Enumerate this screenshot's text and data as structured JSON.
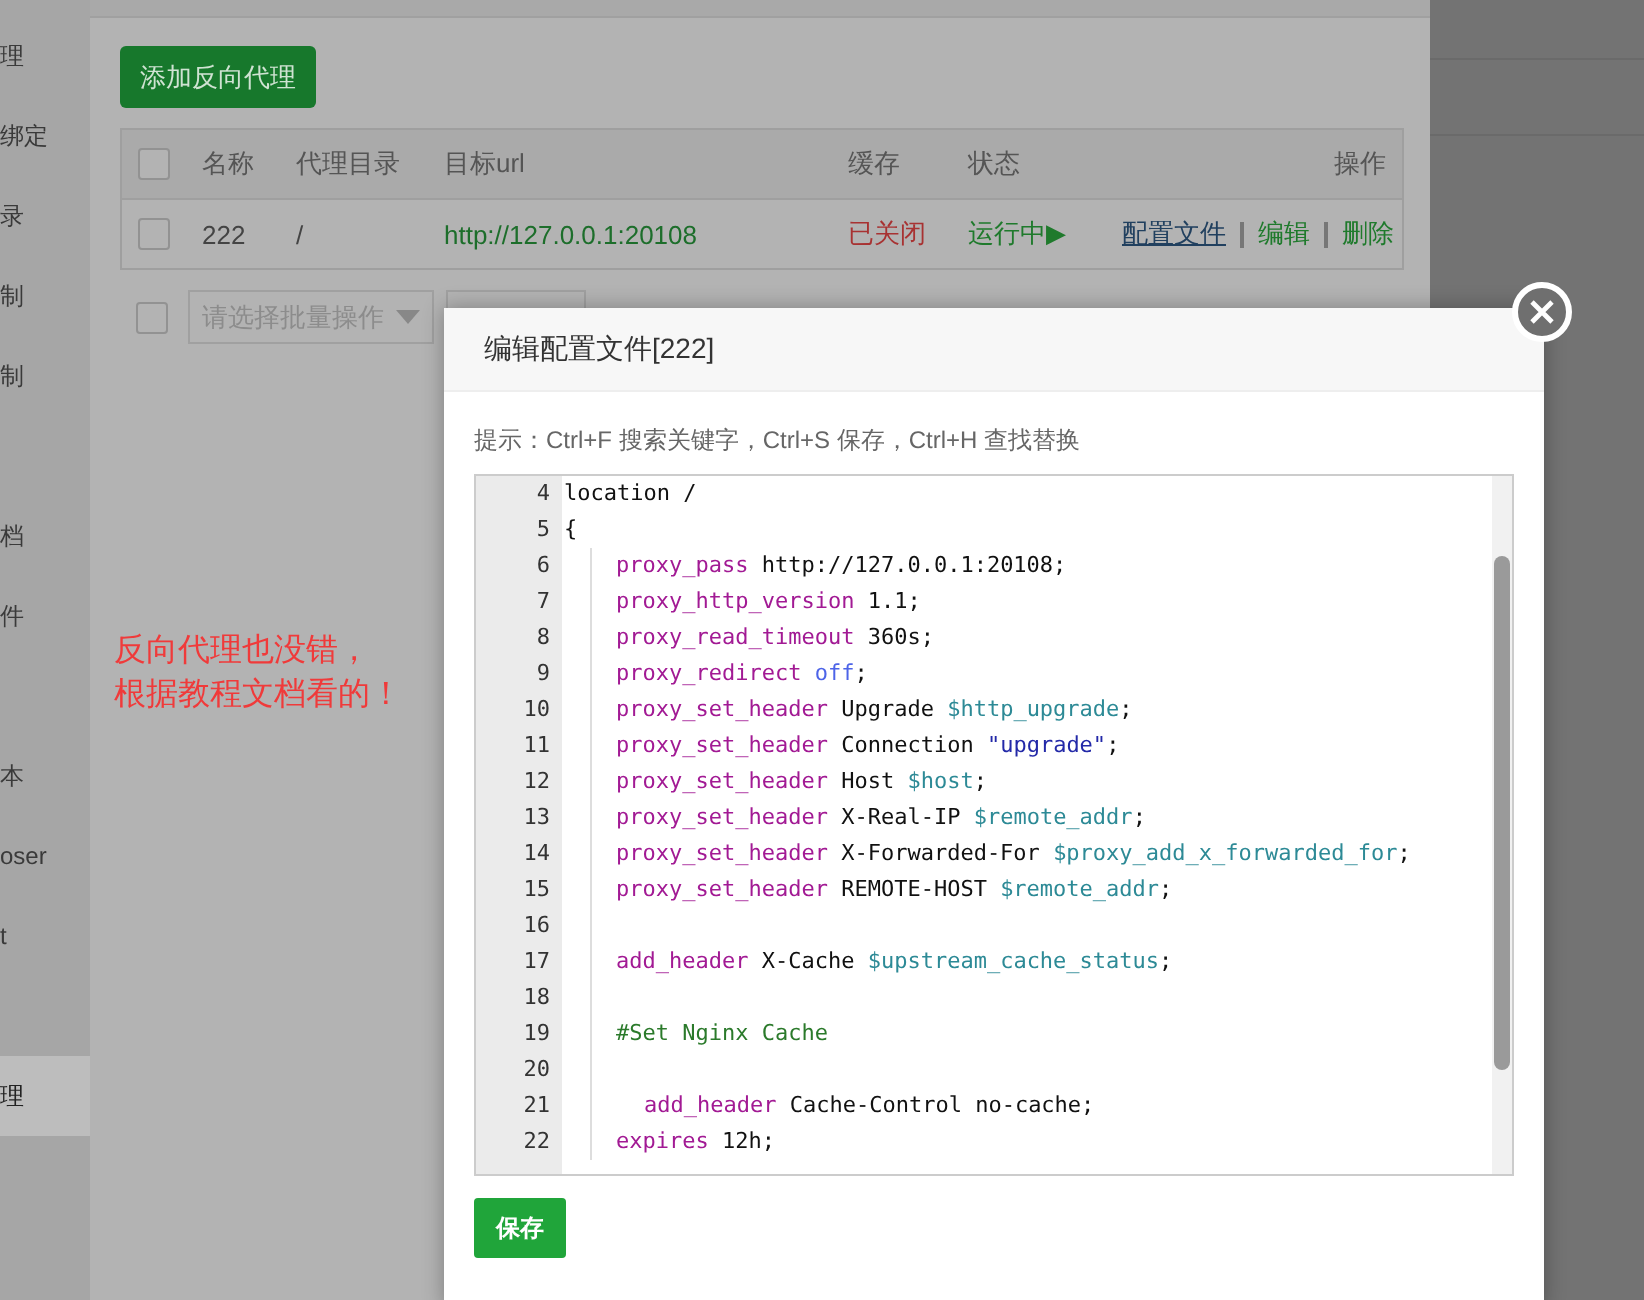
{
  "sidebar": {
    "items": [
      {
        "label": "理",
        "selected": false,
        "kind": "plain"
      },
      {
        "label": "绑定",
        "selected": false,
        "kind": "plain"
      },
      {
        "label": "录",
        "selected": false,
        "kind": "plain"
      },
      {
        "label": "制",
        "selected": false,
        "kind": "plain"
      },
      {
        "label": "制",
        "selected": false,
        "kind": "plain"
      },
      {
        "label": "档",
        "selected": false,
        "kind": "spaced"
      },
      {
        "label": "件",
        "selected": false,
        "kind": "plain"
      },
      {
        "label": "本",
        "selected": false,
        "kind": "spaced"
      },
      {
        "label": "oser",
        "selected": false,
        "kind": "plain"
      },
      {
        "label": "t",
        "selected": false,
        "kind": "plain"
      },
      {
        "label": "理",
        "selected": true,
        "kind": "spaced"
      }
    ]
  },
  "add_button": "添加反向代理",
  "table": {
    "header_checked": false,
    "columns": [
      "名称",
      "代理目录",
      "目标url",
      "缓存",
      "状态",
      "操作"
    ],
    "rows": [
      {
        "checked": false,
        "name": "222",
        "dir": "/",
        "url": "http://127.0.0.1:20108",
        "cache": "已关闭",
        "status": "运行中▶",
        "actions": [
          {
            "label": "配置文件",
            "kind": "link"
          },
          {
            "label": "编辑",
            "kind": "action"
          },
          {
            "label": "删除",
            "kind": "action"
          }
        ]
      }
    ]
  },
  "batch": {
    "checked": false,
    "placeholder": "请选择批量操作"
  },
  "annotation": [
    "反向代理也没错，",
    "根据教程文档看的！"
  ],
  "dialog": {
    "title": "编辑配置文件[222]",
    "hint": "提示：Ctrl+F 搜索关键字，Ctrl+S 保存，Ctrl+H 查找替换",
    "code": [
      {
        "no": "4",
        "kind": "top",
        "tokens": [
          {
            "t": "location /",
            "kind": "plain"
          }
        ]
      },
      {
        "no": "5",
        "kind": "top",
        "tokens": [
          {
            "t": "{",
            "kind": "plain"
          }
        ]
      },
      {
        "no": "6",
        "kind": "nested",
        "tokens": [
          {
            "t": "proxy_pass",
            "kind": "kw"
          },
          {
            "t": " http://127.0.0.1:20108;",
            "kind": "plain"
          }
        ]
      },
      {
        "no": "7",
        "kind": "nested",
        "tokens": [
          {
            "t": "proxy_http_version",
            "kind": "kw"
          },
          {
            "t": " 1.1;",
            "kind": "plain"
          }
        ]
      },
      {
        "no": "8",
        "kind": "nested",
        "tokens": [
          {
            "t": "proxy_read_timeout",
            "kind": "kw"
          },
          {
            "t": " 360s;",
            "kind": "plain"
          }
        ]
      },
      {
        "no": "9",
        "kind": "nested",
        "tokens": [
          {
            "t": "proxy_redirect",
            "kind": "kw"
          },
          {
            "t": " off",
            "kind": "atom"
          },
          {
            "t": ";",
            "kind": "plain"
          }
        ]
      },
      {
        "no": "10",
        "kind": "nested",
        "tokens": [
          {
            "t": "proxy_set_header",
            "kind": "kw"
          },
          {
            "t": " Upgrade ",
            "kind": "plain"
          },
          {
            "t": "$http_upgrade",
            "kind": "var"
          },
          {
            "t": ";",
            "kind": "plain"
          }
        ]
      },
      {
        "no": "11",
        "kind": "nested",
        "tokens": [
          {
            "t": "proxy_set_header",
            "kind": "kw"
          },
          {
            "t": " Connection ",
            "kind": "plain"
          },
          {
            "t": "\"upgrade\"",
            "kind": "string"
          },
          {
            "t": ";",
            "kind": "plain"
          }
        ]
      },
      {
        "no": "12",
        "kind": "nested",
        "tokens": [
          {
            "t": "proxy_set_header",
            "kind": "kw"
          },
          {
            "t": " Host ",
            "kind": "plain"
          },
          {
            "t": "$host",
            "kind": "var"
          },
          {
            "t": ";",
            "kind": "plain"
          }
        ]
      },
      {
        "no": "13",
        "kind": "nested",
        "tokens": [
          {
            "t": "proxy_set_header",
            "kind": "kw"
          },
          {
            "t": " X-Real-IP ",
            "kind": "plain"
          },
          {
            "t": "$remote_addr",
            "kind": "var"
          },
          {
            "t": ";",
            "kind": "plain"
          }
        ]
      },
      {
        "no": "14",
        "kind": "nested",
        "tokens": [
          {
            "t": "proxy_set_header",
            "kind": "kw"
          },
          {
            "t": " X-Forwarded-For ",
            "kind": "plain"
          },
          {
            "t": "$proxy_add_x_forwarded_for",
            "kind": "var"
          },
          {
            "t": ";",
            "kind": "plain"
          }
        ]
      },
      {
        "no": "15",
        "kind": "nested",
        "tokens": [
          {
            "t": "proxy_set_header",
            "kind": "kw"
          },
          {
            "t": " REMOTE-HOST ",
            "kind": "plain"
          },
          {
            "t": "$remote_addr",
            "kind": "var"
          },
          {
            "t": ";",
            "kind": "plain"
          }
        ]
      },
      {
        "no": "16",
        "kind": "nested"
      },
      {
        "no": "17",
        "kind": "nested",
        "tokens": [
          {
            "t": "add_header",
            "kind": "kw"
          },
          {
            "t": " X-Cache ",
            "kind": "plain"
          },
          {
            "t": "$upstream_cache_status",
            "kind": "var"
          },
          {
            "t": ";",
            "kind": "plain"
          }
        ]
      },
      {
        "no": "18",
        "kind": "nested"
      },
      {
        "no": "19",
        "kind": "nested",
        "tokens": [
          {
            "t": "#Set Nginx Cache",
            "kind": "comment"
          }
        ]
      },
      {
        "no": "20",
        "kind": "nested"
      },
      {
        "no": "21",
        "kind": "deep",
        "tokens": [
          {
            "t": "add_header",
            "kind": "kw"
          },
          {
            "t": " Cache-Control no-cache;",
            "kind": "plain"
          }
        ]
      },
      {
        "no": "22",
        "kind": "nested",
        "tokens": [
          {
            "t": "expires",
            "kind": "kw"
          },
          {
            "t": " 12h;",
            "kind": "plain"
          }
        ]
      }
    ],
    "save_button": "保存"
  }
}
